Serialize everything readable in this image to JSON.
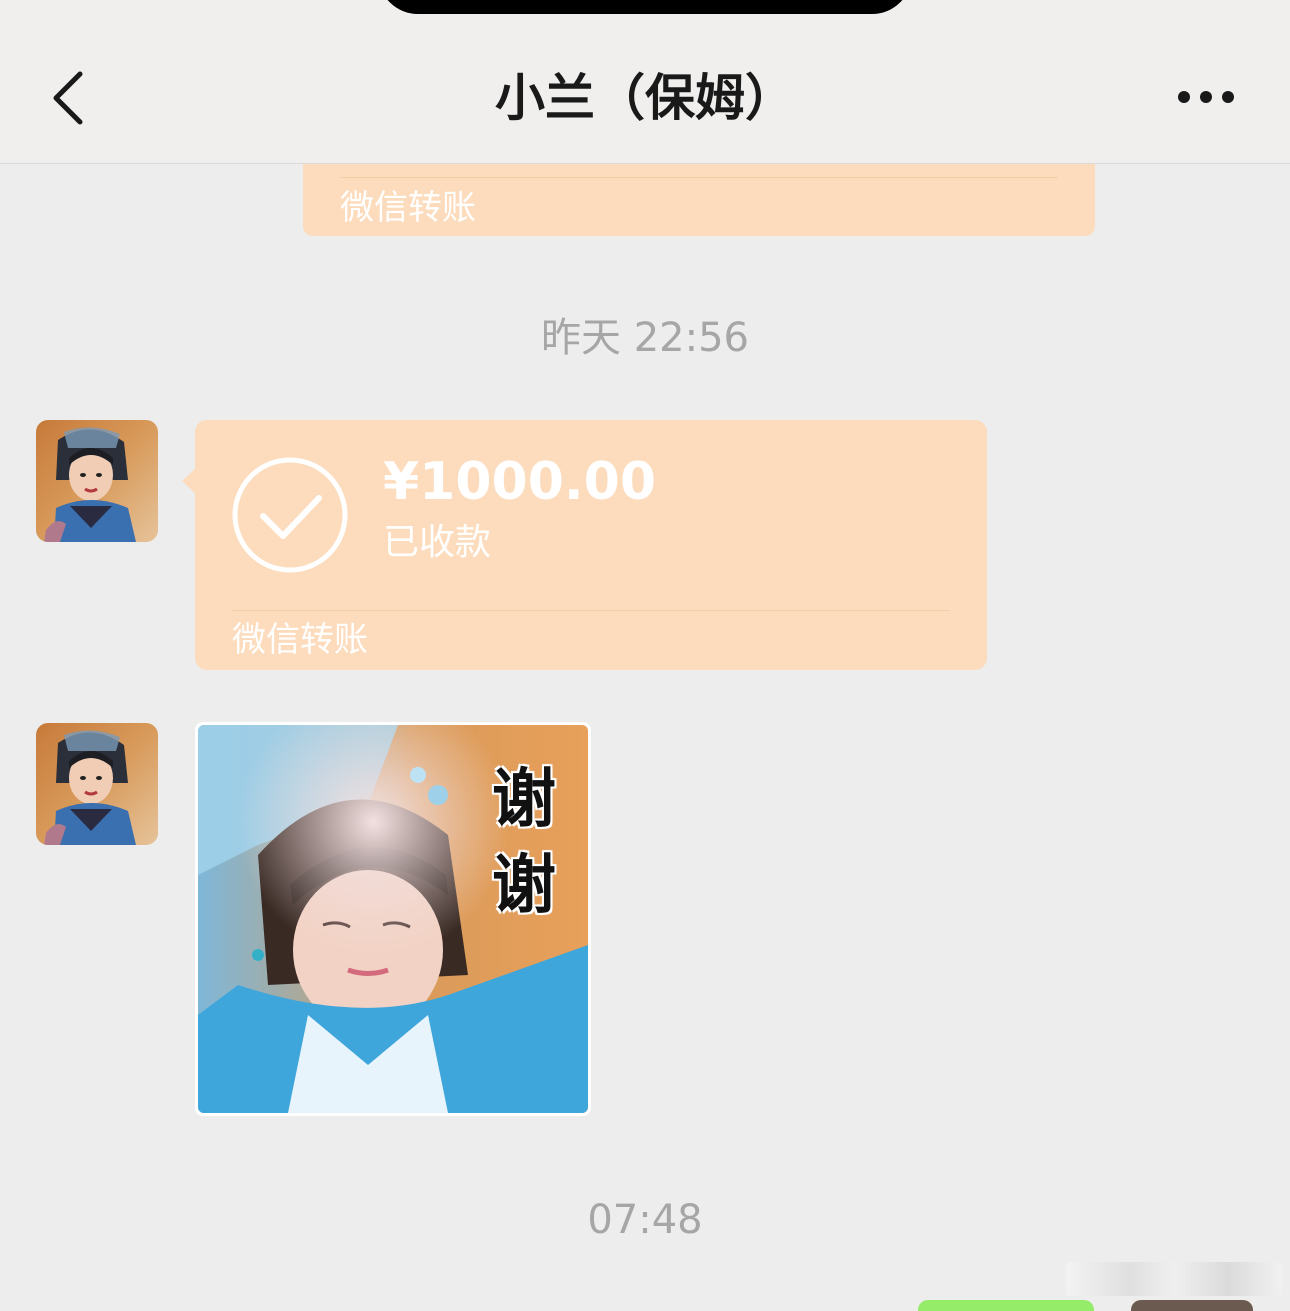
{
  "header": {
    "title": "小兰（保姆）"
  },
  "messages": {
    "prev_transfer_label": "微信转账",
    "timestamp_1": "昨天 22:56",
    "transfer": {
      "amount": "¥1000.00",
      "status": "已收款",
      "label": "微信转账"
    },
    "sticker_caption": "谢谢",
    "timestamp_2": "07:48"
  },
  "colors": {
    "transfer_card": "#fcdcbd",
    "background": "#ededed",
    "sent_bubble": "#95ec69"
  },
  "icons": {
    "back": "chevron-left-icon",
    "more": "more-dots-icon",
    "received": "check-circle-icon"
  }
}
